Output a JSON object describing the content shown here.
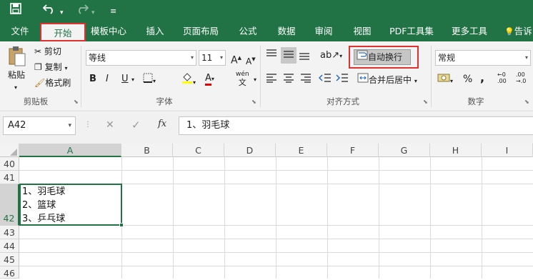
{
  "quick_access": {
    "save_icon": "save-icon",
    "undo_icon": "undo-icon",
    "redo_icon": "redo-icon",
    "customize_icon": "customize-icon"
  },
  "tabs": [
    {
      "label": "文件"
    },
    {
      "label": "开始",
      "active": true
    },
    {
      "label": "模板中心"
    },
    {
      "label": "插入"
    },
    {
      "label": "页面布局"
    },
    {
      "label": "公式"
    },
    {
      "label": "数据"
    },
    {
      "label": "审阅"
    },
    {
      "label": "视图"
    },
    {
      "label": "PDF工具集"
    },
    {
      "label": "更多工具"
    }
  ],
  "tell_me": "告诉",
  "ribbon": {
    "clipboard": {
      "paste": "粘贴",
      "cut": "剪切",
      "copy": "复制",
      "format_painter": "格式刷",
      "group_label": "剪贴板"
    },
    "font": {
      "font_name": "等线",
      "font_size": "11",
      "bold": "B",
      "italic": "I",
      "underline": "U",
      "grow": "A",
      "shrink": "A",
      "font_color_glyph": "A",
      "phonetic": "wén",
      "group_label": "字体"
    },
    "alignment": {
      "wrap_text": "自动换行",
      "merge_center": "合并后居中",
      "group_label": "对齐方式"
    },
    "number": {
      "format": "常规",
      "percent": "%",
      "comma": ",",
      "group_label": "数字"
    }
  },
  "formula_bar": {
    "name_box": "A42",
    "cancel_glyph": "✕",
    "enter_glyph": "✓",
    "fx": "fx",
    "value": "1、羽毛球"
  },
  "columns": [
    "A",
    "B",
    "C",
    "D",
    "E",
    "F",
    "G",
    "H",
    "I"
  ],
  "rows": [
    "40",
    "41",
    "42",
    "43",
    "44",
    "45",
    "46"
  ],
  "cell_A42": {
    "lines": [
      "1、羽毛球",
      "2、篮球",
      "3、乒乓球"
    ]
  },
  "colors": {
    "brand": "#217346",
    "highlight_border": "#e03030",
    "selection": "#217346"
  }
}
